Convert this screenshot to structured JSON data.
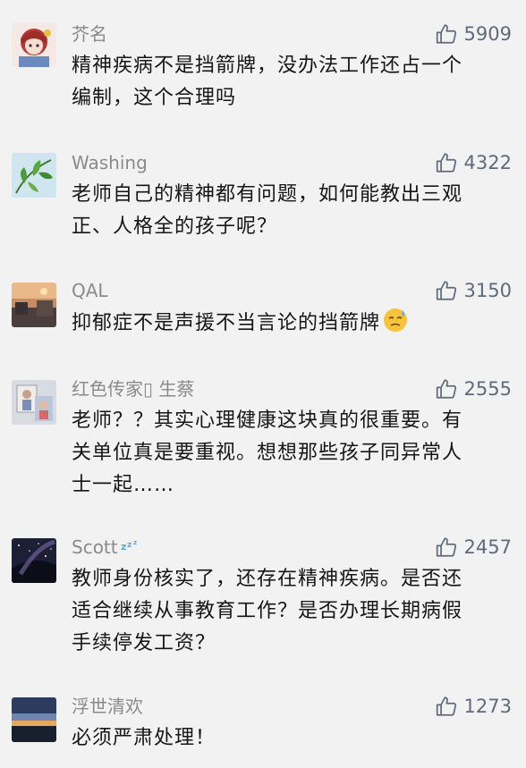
{
  "comments": [
    {
      "username": "芥名",
      "likes": "5909",
      "lines": [
        "精神疾病不是挡箭牌，没办法工作还占一个",
        "编制，这个合理吗"
      ],
      "avatar": "anime-girl-avatar"
    },
    {
      "username": "Washing",
      "likes": "4322",
      "lines": [
        "老师自己的精神都有问题，如何能教出三观",
        "正、人格全的孩子呢？"
      ],
      "avatar": "green-leaves-avatar"
    },
    {
      "username": "QAL",
      "likes": "3150",
      "lines": [
        "抑郁症不是声援不当言论的挡箭牌"
      ],
      "emoji": "sweat-face-emoji",
      "avatar": "sunset-scene-avatar"
    },
    {
      "username": "红色传家▯ 生蔡",
      "likes": "2555",
      "lines": [
        "老师？？其实心理健康这块真的很重要。有",
        "关单位真是要重视。想想那些孩子同异常人",
        "士一起……"
      ],
      "avatar": "photo-frame-avatar"
    },
    {
      "username": "Scott",
      "username_suffix": "zzz",
      "likes": "2457",
      "lines": [
        "教师身份核实了，还存在精神疾病。是否还",
        "适合继续从事教育工作？是否办理长期病假",
        "手续停发工资？"
      ],
      "avatar": "night-sky-avatar"
    },
    {
      "username": "浮世清欢",
      "likes": "1273",
      "lines": [
        "必须严肃处理！"
      ],
      "avatar": "horizon-avatar"
    }
  ],
  "icons": {
    "like": "thumbs-up-icon"
  },
  "colors": {
    "background": "#f2f2f2",
    "username": "#8a8a8a",
    "like": "#5f6a7d",
    "text": "#161616"
  }
}
